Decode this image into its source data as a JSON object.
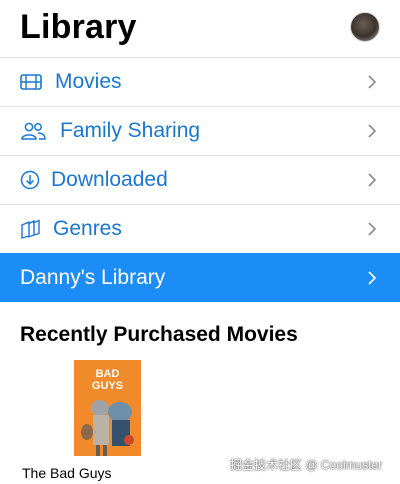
{
  "header": {
    "title": "Library"
  },
  "list": [
    {
      "label": "Movies",
      "icon": "film-icon"
    },
    {
      "label": "Family Sharing",
      "icon": "people-icon"
    },
    {
      "label": "Downloaded",
      "icon": "download-circle-icon"
    },
    {
      "label": "Genres",
      "icon": "genres-icon"
    },
    {
      "label": "Danny's Library",
      "selected": true
    }
  ],
  "section": {
    "title": "Recently Purchased Movies"
  },
  "movie": {
    "poster_title": "THE BAD GUYS",
    "caption": "The Bad Guys"
  },
  "watermark": "掘金技术社区 @ Coolmuster",
  "colors": {
    "accent": "#1978d4",
    "selected_bg": "#1c8cf7",
    "poster_bg": "#f08a2a"
  }
}
